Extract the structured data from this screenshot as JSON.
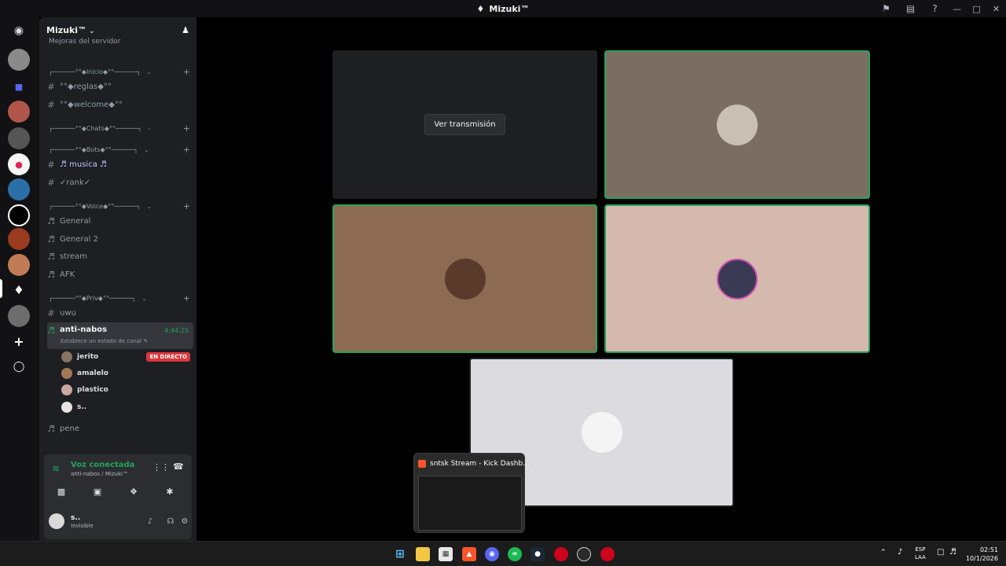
{
  "window": {
    "title": "Mizuki™"
  },
  "server": {
    "name": "Mizuki™",
    "partial_item": "Mejoras del servidor"
  },
  "categories": [
    {
      "label": "┌──────°°◆Inicio◆°°──────┐"
    },
    {
      "label": "┌──────°°◆Chats◆°°──────┐"
    },
    {
      "label": "┌──────°°◆Bots◆°°──────┐"
    },
    {
      "label": "┌──────°°◆Voice◆°°──────┐"
    },
    {
      "label": "┌──────°°◆Priv◆°°──────┐"
    }
  ],
  "channels": {
    "reglas": "°°◆reglas◆°°",
    "welcome": "°°◆welcome◆°°",
    "musica": "♬ musica ♬",
    "rank": "✓rank✓",
    "general": "General",
    "general2": "General 2",
    "stream": "stream",
    "afk": "AFK",
    "uwu": "uwu",
    "active": "anti-nabos",
    "active_timer": "4:44:25",
    "active_status": "Establece un estado de canal",
    "pene": "pene"
  },
  "members": [
    {
      "name": "jerito",
      "badge": "EN DIRECTO"
    },
    {
      "name": "amalelo",
      "badge": ""
    },
    {
      "name": "plastico",
      "badge": ""
    },
    {
      "name": "s..",
      "badge": ""
    }
  ],
  "voice_panel": {
    "status": "Voz conectada",
    "location": "anti-nabos / Mizuki™"
  },
  "user": {
    "name": "s..",
    "status": "Invisible"
  },
  "stage": {
    "watch_stream_label": "Ver transmisión"
  },
  "thumbnail": {
    "title": "sntsk Stream - Kick Dashb..."
  },
  "taskbar": {
    "lang_line1": "ESP",
    "lang_line2": "LAA",
    "time": "02:51",
    "date": "10/1/2026"
  },
  "colors": {
    "speaking_border": "#23a55a",
    "live_badge": "#da373c",
    "tile_1": "#7c6d63",
    "tile_2": "#8d6b53",
    "tile_3": "#d5b8ae",
    "tile_4": "#dcdce0"
  }
}
